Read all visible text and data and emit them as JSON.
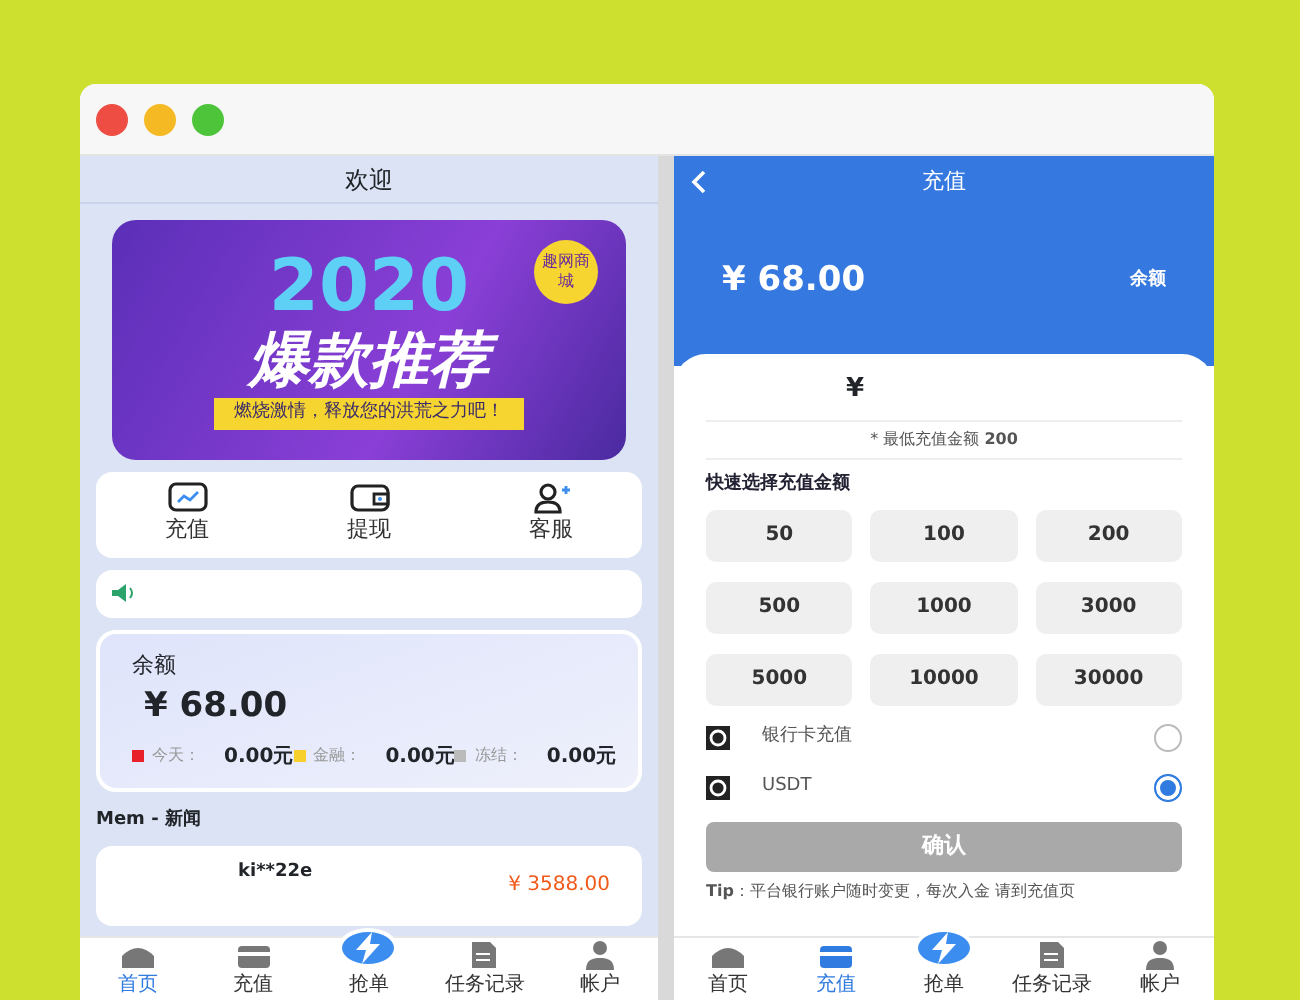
{
  "left": {
    "title": "欢迎",
    "banner": {
      "headline": "2020",
      "subtitle": "爆款推荐",
      "tag": "趣网商城",
      "slogan": "燃烧激情，释放您的洪荒之力吧！"
    },
    "actions": [
      {
        "label": "充值"
      },
      {
        "label": "提现"
      },
      {
        "label": "客服"
      }
    ],
    "balance": {
      "label": "余额",
      "amount": "¥ 68.00",
      "stats": [
        {
          "label": "今天：",
          "value": "0.00元",
          "color": "#e8202a"
        },
        {
          "label": "金融：",
          "value": "0.00元",
          "color": "#f7d02c"
        },
        {
          "label": "冻结：",
          "value": "0.00元",
          "color": "#bbbbbb"
        }
      ]
    },
    "news": {
      "title": "Mem - 新闻",
      "items": [
        {
          "user": "ki**22e",
          "amount": "¥ 3588.00"
        }
      ]
    },
    "tabbar": [
      {
        "label": "首页",
        "selected": true
      },
      {
        "label": "充值",
        "selected": false
      },
      {
        "label": "抢单",
        "selected": false
      },
      {
        "label": "任务记录",
        "selected": false
      },
      {
        "label": "帐户",
        "selected": false
      }
    ]
  },
  "right": {
    "title": "充值",
    "balance": {
      "amount": "¥ 68.00",
      "label": "余额"
    },
    "currency": "¥",
    "minimum": "* 最低充值金额 **200**",
    "quick_title": "快速选择充值金额",
    "amounts": [
      "50",
      "100",
      "200",
      "500",
      "1000",
      "3000",
      "5000",
      "10000",
      "30000"
    ],
    "methods": [
      {
        "name": "银行卡充值",
        "selected": false
      },
      {
        "name": "USDT",
        "selected": true
      }
    ],
    "confirm": {
      "label": "确认",
      "disabled": true
    },
    "tip": "**Tip**：平台银行账户随时变更，每次入金 请到充值页",
    "tabbar": [
      {
        "label": "首页",
        "selected": false
      },
      {
        "label": "充值",
        "selected": true
      },
      {
        "label": "抢单",
        "selected": false
      },
      {
        "label": "任务记录",
        "selected": false
      },
      {
        "label": "帐户",
        "selected": false
      }
    ]
  }
}
